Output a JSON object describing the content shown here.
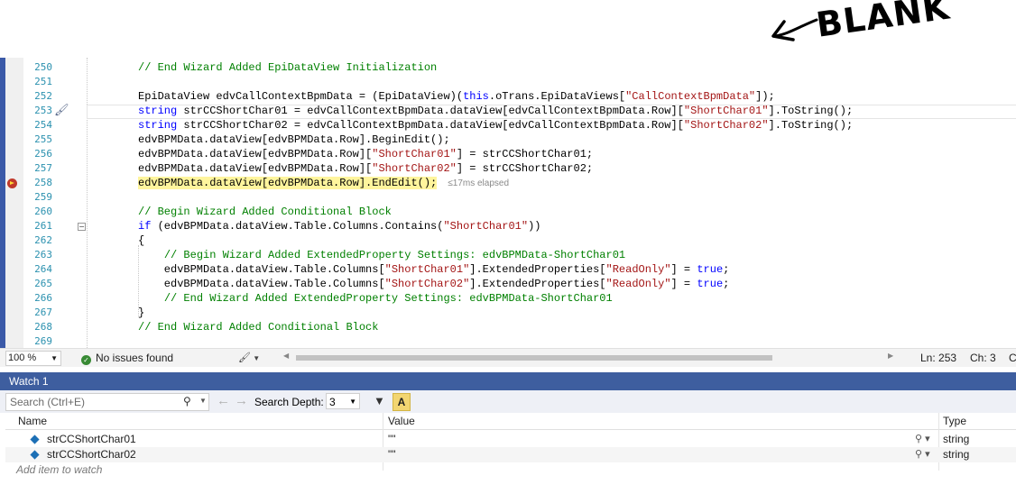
{
  "annotation": {
    "text": "BLANK"
  },
  "editor": {
    "lines": [
      {
        "num": "250",
        "segs": [
          [
            "cmt",
            "// End Wizard Added EpiDataView Initialization"
          ]
        ]
      },
      {
        "num": "251",
        "segs": []
      },
      {
        "num": "252",
        "segs": [
          [
            "plain",
            "EpiDataView edvCallContextBpmData = (EpiDataView)("
          ],
          [
            "kw",
            "this"
          ],
          [
            "plain",
            ".oTrans.EpiDataViews["
          ],
          [
            "str",
            "\"CallContextBpmData\""
          ],
          [
            "plain",
            "]);"
          ]
        ]
      },
      {
        "num": "253",
        "segs": [
          [
            "kw",
            "string"
          ],
          [
            "plain",
            " strCCShortChar01 = edvCallContextBpmData.dataView[edvCallContextBpmData.Row]["
          ],
          [
            "str",
            "\"ShortChar01\""
          ],
          [
            "plain",
            "].ToString();"
          ]
        ]
      },
      {
        "num": "254",
        "segs": [
          [
            "kw",
            "string"
          ],
          [
            "plain",
            " strCCShortChar02 = edvCallContextBpmData.dataView[edvCallContextBpmData.Row]["
          ],
          [
            "str",
            "\"ShortChar02\""
          ],
          [
            "plain",
            "].ToString();"
          ]
        ]
      },
      {
        "num": "255",
        "segs": [
          [
            "plain",
            "edvBPMData.dataView[edvBPMData.Row].BeginEdit();"
          ]
        ]
      },
      {
        "num": "256",
        "segs": [
          [
            "plain",
            "edvBPMData.dataView[edvBPMData.Row]["
          ],
          [
            "str",
            "\"ShortChar01\""
          ],
          [
            "plain",
            "] = strCCShortChar01;"
          ]
        ]
      },
      {
        "num": "257",
        "segs": [
          [
            "plain",
            "edvBPMData.dataView[edvBPMData.Row]["
          ],
          [
            "str",
            "\"ShortChar02\""
          ],
          [
            "plain",
            "] = strCCShortChar02;"
          ]
        ]
      },
      {
        "num": "258",
        "segs": [
          [
            "hl",
            "edvBPMData.dataView[edvBPMData.Row].EndEdit();"
          ]
        ],
        "elapsed": "≤17ms elapsed"
      },
      {
        "num": "259",
        "segs": []
      },
      {
        "num": "260",
        "segs": [
          [
            "cmt",
            "// Begin Wizard Added Conditional Block"
          ]
        ]
      },
      {
        "num": "261",
        "segs": [
          [
            "kw",
            "if"
          ],
          [
            "plain",
            " (edvBPMData.dataView.Table.Columns.Contains("
          ],
          [
            "str",
            "\"ShortChar01\""
          ],
          [
            "plain",
            "))"
          ]
        ]
      },
      {
        "num": "262",
        "segs": [
          [
            "plain",
            "{"
          ]
        ]
      },
      {
        "num": "263",
        "segs": [
          [
            "plain",
            "    "
          ],
          [
            "cmt",
            "// Begin Wizard Added ExtendedProperty Settings: edvBPMData-ShortChar01"
          ]
        ]
      },
      {
        "num": "264",
        "segs": [
          [
            "plain",
            "    edvBPMData.dataView.Table.Columns["
          ],
          [
            "str",
            "\"ShortChar01\""
          ],
          [
            "plain",
            "].ExtendedProperties["
          ],
          [
            "str",
            "\"ReadOnly\""
          ],
          [
            "plain",
            "] = "
          ],
          [
            "kw",
            "true"
          ],
          [
            "plain",
            ";"
          ]
        ]
      },
      {
        "num": "265",
        "segs": [
          [
            "plain",
            "    edvBPMData.dataView.Table.Columns["
          ],
          [
            "str",
            "\"ShortChar02\""
          ],
          [
            "plain",
            "].ExtendedProperties["
          ],
          [
            "str",
            "\"ReadOnly\""
          ],
          [
            "plain",
            "] = "
          ],
          [
            "kw",
            "true"
          ],
          [
            "plain",
            ";"
          ]
        ]
      },
      {
        "num": "266",
        "segs": [
          [
            "plain",
            "    "
          ],
          [
            "cmt",
            "// End Wizard Added ExtendedProperty Settings: edvBPMData-ShortChar01"
          ]
        ]
      },
      {
        "num": "267",
        "segs": [
          [
            "plain",
            "}"
          ]
        ]
      },
      {
        "num": "268",
        "segs": [
          [
            "cmt",
            "// End Wizard Added Conditional Block"
          ]
        ]
      },
      {
        "num": "269",
        "segs": []
      }
    ]
  },
  "status_bar": {
    "zoom": "100 %",
    "issues": "No issues found",
    "line": "Ln: 253",
    "col": "Ch: 3",
    "extra": "C"
  },
  "watch": {
    "title": "Watch 1",
    "search_placeholder": "Search (Ctrl+E)",
    "search_depth_label": "Search Depth:",
    "search_depth_value": "3",
    "columns": {
      "name": "Name",
      "value": "Value",
      "type": "Type"
    },
    "rows": [
      {
        "name": "strCCShortChar01",
        "value": "\"\"",
        "type": "string"
      },
      {
        "name": "strCCShortChar02",
        "value": "\"\"",
        "type": "string"
      }
    ],
    "add_item": "Add item to watch"
  }
}
